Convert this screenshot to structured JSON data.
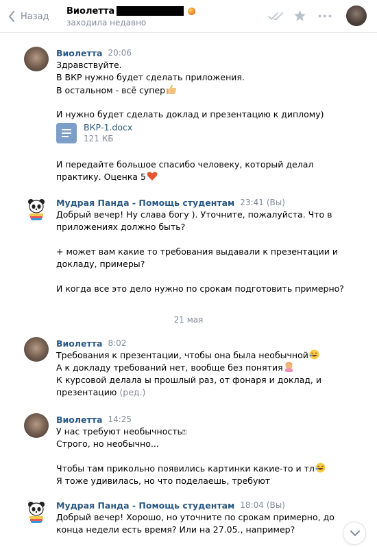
{
  "header": {
    "back_label": "Назад",
    "contact_name": "Виолетта",
    "contact_status": "заходила недавно"
  },
  "icons": {
    "back": "chevron-left-icon",
    "read": "double-check-icon",
    "star": "star-icon",
    "more": "more-dots-icon",
    "scroll_down": "chevron-down-icon"
  },
  "colors": {
    "author_link": "#2a5885",
    "muted": "#828a99",
    "doc_icon": "#7d9ec9",
    "divider": "#e7e8ec"
  },
  "messages": [
    {
      "author": "Виолетта",
      "time": "20:06",
      "lines": [
        "Здравствуйте.",
        "В ВКР нужно будет сделать приложения.",
        "В остальном - всё супер",
        "",
        "И нужно будет сделать доклад и презентацию к диплому)"
      ],
      "attachment": {
        "name": "ВКР-1.docx",
        "size": "121 КБ"
      },
      "lines_after": [
        "И передайте большое спасибо человеку, который делал",
        "практику. Оценка 5"
      ]
    },
    {
      "author": "Мудрая Панда - Помощь студентам",
      "time": "23:41",
      "you": "(Вы)",
      "lines": [
        "Добрый вечер! Ну слава богу ). Уточните, пожалуйста. Что в",
        "приложениях должно быть?",
        "",
        "+ может вам какие то требования выдавали к презентации и",
        "докладу, примеры?",
        "",
        "И когда все это дело нужно по срокам подготовить примерно?"
      ]
    },
    {
      "author": "Виолетта",
      "time": "8:02",
      "lines": [
        "Требования к презентации, чтобы она была необычной",
        "А к докладу требований нет, вообще без понятия",
        "К курсовой делала ы прошлый раз, от фонаря и доклад, и",
        "презентацию"
      ],
      "edited": "(ред.)"
    },
    {
      "author": "Виолетта",
      "time": "14:25",
      "lines": [
        "У нас требуют необычность",
        "Строго, но необычно...",
        "",
        "Чтобы там прикольно появились картинки какие-то и тл",
        "Я тоже удивилась, но что поделаешь, требуют"
      ]
    },
    {
      "author": "Мудрая Панда - Помощь студентам",
      "time": "18:04",
      "you": "(Вы)",
      "lines": [
        "Добрый вечер! Хорошо, но уточните по срокам примерно, до",
        "конца недели есть время? Или на 27.05., например?"
      ]
    }
  ],
  "date_separator": "21 мая",
  "box_glyph": "⍰"
}
